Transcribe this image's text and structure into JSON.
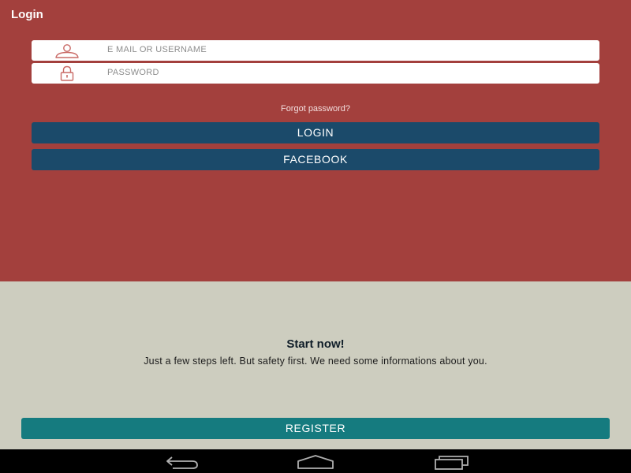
{
  "header": {
    "title": "Login"
  },
  "form": {
    "username_placeholder": "E MAIL  OR USERNAME",
    "password_placeholder": "PASSWORD",
    "forgot_label": "Forgot password?",
    "login_label": "LOGIN",
    "facebook_label": "FACEBOOK"
  },
  "register_section": {
    "title": "Start now!",
    "subtitle": "Just a few steps left. But safety first. We need some informations about you.",
    "register_label": "REGISTER"
  },
  "icons": {
    "user": "user-icon",
    "lock": "lock-icon",
    "back": "back-icon",
    "home": "home-icon",
    "recents": "recent-apps-icon"
  },
  "colors": {
    "top_background": "#a3403d",
    "bottom_background": "#cdcdbf",
    "primary_button": "#1b4a6a",
    "register_button": "#157b7f",
    "icon_accent": "#c96a66"
  }
}
